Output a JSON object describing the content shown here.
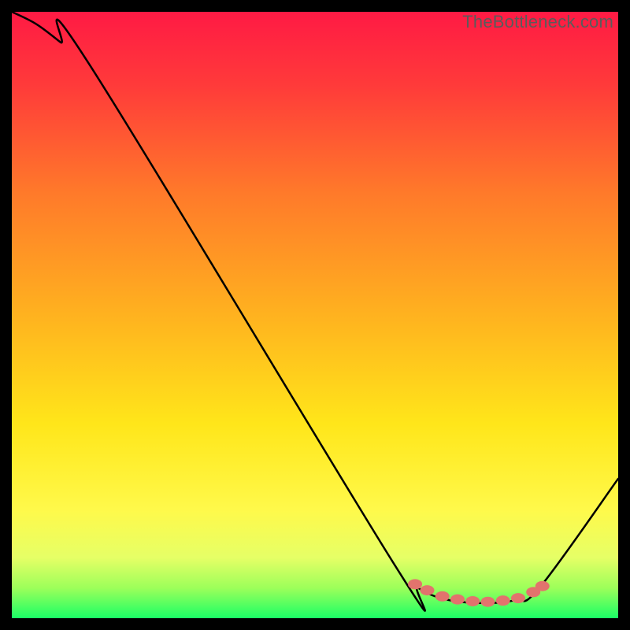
{
  "watermark": "TheBottleneck.com",
  "gradient": {
    "stops": [
      {
        "offset": "0%",
        "color": "#ff1a44"
      },
      {
        "offset": "12%",
        "color": "#ff3a3a"
      },
      {
        "offset": "30%",
        "color": "#ff7a2a"
      },
      {
        "offset": "50%",
        "color": "#ffb21f"
      },
      {
        "offset": "68%",
        "color": "#ffe61a"
      },
      {
        "offset": "82%",
        "color": "#fff94a"
      },
      {
        "offset": "90%",
        "color": "#e6ff66"
      },
      {
        "offset": "95%",
        "color": "#9dff5a"
      },
      {
        "offset": "100%",
        "color": "#1aff66"
      }
    ]
  },
  "marker_color": "#e2736d",
  "chart_data": {
    "type": "line",
    "title": "",
    "xlabel": "",
    "ylabel": "",
    "xlim": [
      0,
      100
    ],
    "ylim": [
      0,
      100
    ],
    "series": [
      {
        "name": "bottleneck-curve",
        "x": [
          0,
          4,
          8,
          13,
          63,
          67,
          72,
          78,
          83,
          87,
          100
        ],
        "y": [
          100,
          98,
          95,
          91,
          9,
          5,
          3,
          2.5,
          3,
          5,
          23
        ]
      }
    ],
    "markers": {
      "name": "highlight-points",
      "x": [
        66.5,
        68.5,
        71,
        73.5,
        76,
        78.5,
        81,
        83.5,
        86,
        87.5
      ],
      "y": [
        5.6,
        4.6,
        3.6,
        3.1,
        2.8,
        2.7,
        2.9,
        3.3,
        4.3,
        5.3
      ]
    }
  }
}
